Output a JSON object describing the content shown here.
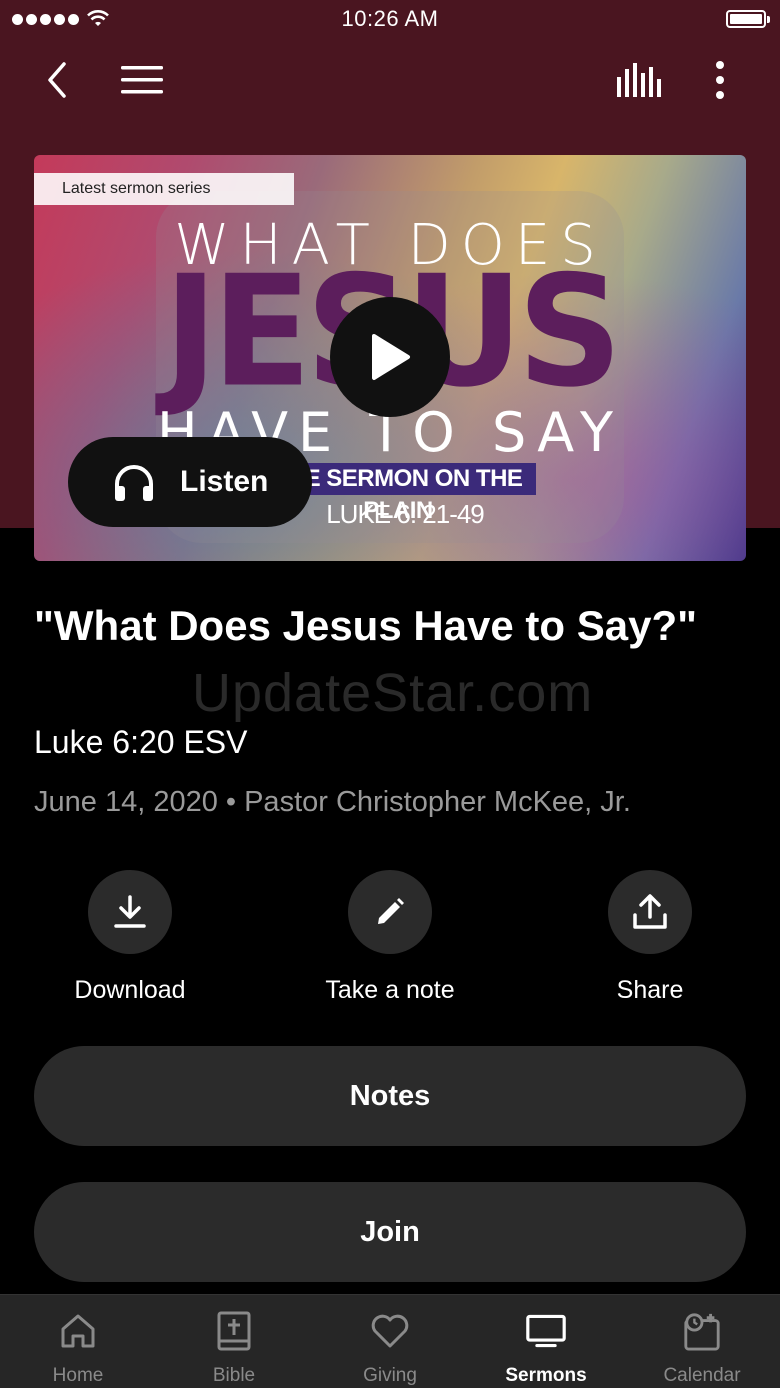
{
  "status_bar": {
    "time": "10:26 AM"
  },
  "hero": {
    "series_label": "Latest sermon series",
    "art_line1": "WHAT DOES",
    "art_line2": "JESUS",
    "art_line3": "HAVE TO SAY",
    "art_banner": "THE SERMON ON THE PLAIN",
    "art_reference": "LUKE 6: 21-49",
    "listen_label": "Listen"
  },
  "sermon": {
    "title": "\"What Does Jesus Have to Say?\"",
    "scripture": "Luke 6:20 ESV",
    "meta": "June 14, 2020 • Pastor Christopher McKee, Jr."
  },
  "watermark": "UpdateStar.com",
  "actions": {
    "download": "Download",
    "note": "Take a note",
    "share": "Share"
  },
  "buttons": {
    "notes": "Notes",
    "join": "Join"
  },
  "tabs": [
    {
      "label": "Home",
      "icon": "home-icon",
      "active": false
    },
    {
      "label": "Bible",
      "icon": "bible-icon",
      "active": false
    },
    {
      "label": "Giving",
      "icon": "heart-icon",
      "active": false
    },
    {
      "label": "Sermons",
      "icon": "tv-icon",
      "active": true
    },
    {
      "label": "Calendar",
      "icon": "calendar-icon",
      "active": false
    }
  ],
  "colors": {
    "header": "#4a1520",
    "surface": "#2b2b2b",
    "tabbar": "#262626"
  }
}
